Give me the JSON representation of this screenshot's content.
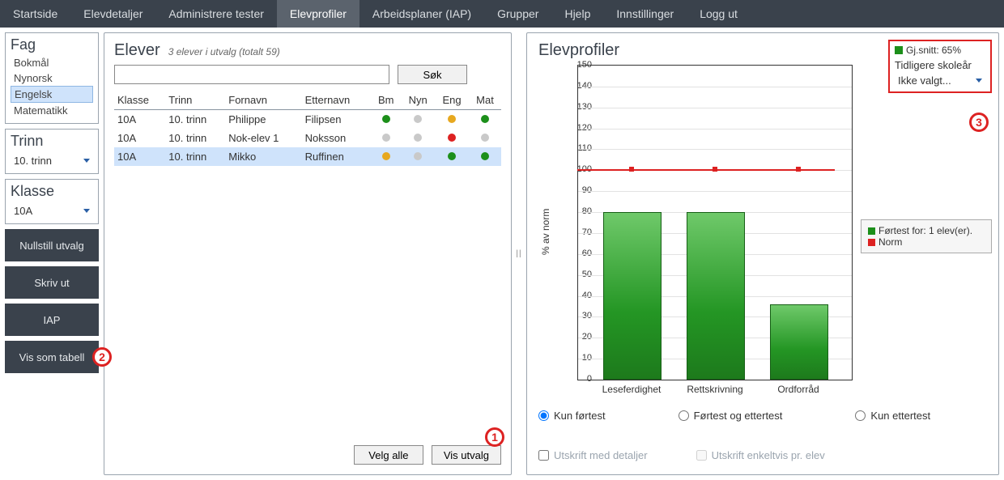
{
  "nav": {
    "items": [
      {
        "label": "Startside"
      },
      {
        "label": "Elevdetaljer"
      },
      {
        "label": "Administrere tester"
      },
      {
        "label": "Elevprofiler",
        "active": true
      },
      {
        "label": "Arbeidsplaner (IAP)"
      },
      {
        "label": "Grupper"
      },
      {
        "label": "Hjelp"
      },
      {
        "label": "Innstillinger"
      },
      {
        "label": "Logg ut"
      }
    ]
  },
  "sidebar": {
    "fag_title": "Fag",
    "fag": [
      {
        "label": "Bokmål"
      },
      {
        "label": "Nynorsk"
      },
      {
        "label": "Engelsk",
        "selected": true
      },
      {
        "label": "Matematikk"
      }
    ],
    "trinn_title": "Trinn",
    "trinn_value": "10. trinn",
    "klasse_title": "Klasse",
    "klasse_value": "10A",
    "buttons": {
      "reset": "Nullstill utvalg",
      "print": "Skriv ut",
      "iap": "IAP",
      "table": "Vis som tabell"
    }
  },
  "elever": {
    "title": "Elever",
    "subtitle": "3 elever i utvalg (totalt 59)",
    "search_placeholder": "",
    "search_btn": "Søk",
    "columns": {
      "klasse": "Klasse",
      "trinn": "Trinn",
      "fornavn": "Fornavn",
      "etternavn": "Etternavn",
      "bm": "Bm",
      "nyn": "Nyn",
      "eng": "Eng",
      "mat": "Mat"
    },
    "rows": [
      {
        "klasse": "10A",
        "trinn": "10. trinn",
        "fornavn": "Philippe",
        "etternavn": "Filipsen",
        "bm": "green",
        "nyn": "grey",
        "eng": "orange",
        "mat": "green"
      },
      {
        "klasse": "10A",
        "trinn": "10. trinn",
        "fornavn": "Nok-elev 1",
        "etternavn": "Noksson",
        "bm": "grey",
        "nyn": "grey",
        "eng": "red",
        "mat": "grey"
      },
      {
        "klasse": "10A",
        "trinn": "10. trinn",
        "fornavn": "Mikko",
        "etternavn": "Ruffinen",
        "bm": "orange",
        "nyn": "grey",
        "eng": "green",
        "mat": "green",
        "selected": true
      }
    ],
    "select_all": "Velg alle",
    "show_sel": "Vis utvalg"
  },
  "chart": {
    "title": "Elevprofiler",
    "avg_label": "Gj.snitt: 65%",
    "prev_label": "Tidligere skoleår",
    "prev_value": "Ikke valgt...",
    "ylabel": "% av norm",
    "legend_pretest": "Førtest for: 1 elev(er).",
    "legend_norm": "Norm",
    "radio_pre": "Kun førtest",
    "radio_both": "Førtest og ettertest",
    "radio_post": "Kun ettertest",
    "chk_detail": "Utskrift med detaljer",
    "chk_per": "Utskrift enkeltvis pr. elev"
  },
  "annotations": {
    "one": "1",
    "two": "2",
    "three": "3"
  },
  "chart_data": {
    "type": "bar",
    "categories": [
      "Leseferdighet",
      "Rettskrivning",
      "Ordforråd"
    ],
    "values": [
      80,
      80,
      36
    ],
    "norm_line": 100,
    "title": "Elevprofiler",
    "ylabel": "% av norm",
    "ylim": [
      0,
      150
    ],
    "ytick_step": 10,
    "series_name": "Førtest for: 1 elev(er).",
    "reference_name": "Norm"
  }
}
